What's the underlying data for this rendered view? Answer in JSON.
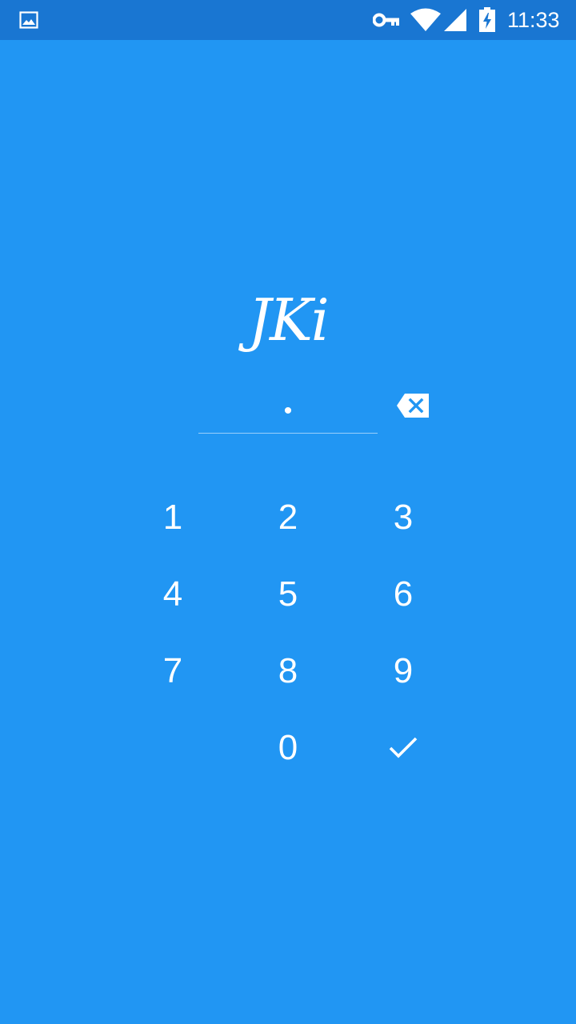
{
  "status_bar": {
    "time": "11:33",
    "icons": [
      "gallery-icon",
      "vpn-key-icon",
      "wifi-icon",
      "cell-signal-icon",
      "battery-charging-icon"
    ]
  },
  "logo": {
    "text": "JKi"
  },
  "pin": {
    "value": "•"
  },
  "keypad": {
    "k1": "1",
    "k2": "2",
    "k3": "3",
    "k4": "4",
    "k5": "5",
    "k6": "6",
    "k7": "7",
    "k8": "8",
    "k9": "9",
    "k0": "0"
  },
  "colors": {
    "background": "#2196F3",
    "status_bar": "#1976D2",
    "foreground": "#FFFFFF"
  }
}
